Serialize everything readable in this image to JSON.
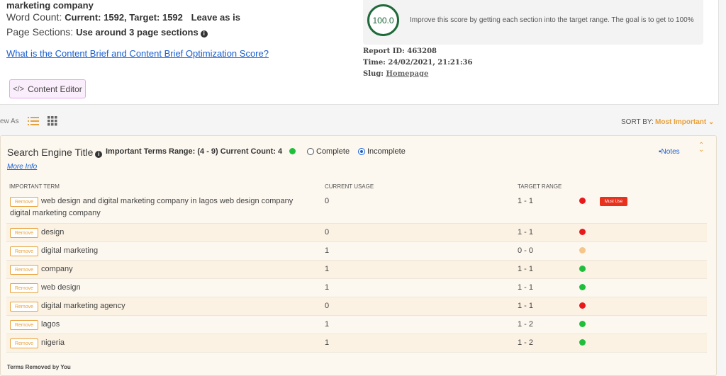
{
  "brief": {
    "company_line": "marketing company",
    "word_count_label": "Word Count:",
    "word_count_value": "Current: 1592, Target: 1592",
    "word_count_note": "Leave as is",
    "page_sections_label": "Page Sections:",
    "page_sections_value": "Use around 3 page sections",
    "brief_link": "What is the Content Brief and Content Brief Optimization Score?",
    "content_editor_label": "Content Editor"
  },
  "score": {
    "value": "100.0",
    "text": "Improve this score by getting each section into the target range. The goal is to get to 100%"
  },
  "report": {
    "id_label": "Report ID:",
    "id_value": "463208",
    "time_label": "Time:",
    "time_value": "24/02/2021, 21:21:36",
    "slug_label": "Slug:",
    "slug_value": "Homepage"
  },
  "view": {
    "view_as_label": "ew As",
    "sort_label": "SORT BY:",
    "sort_value": "Most Important",
    "sort_chevron": "⌄"
  },
  "section": {
    "title": "Search Engine Title",
    "terms_range": "Important Terms Range: (4 - 9) Current Count: 4",
    "status_color": "#1fbf3c",
    "complete_label": "Complete",
    "incomplete_label": "Incomplete",
    "selected": "Incomplete",
    "notes_label": "Notes",
    "collapse_glyph": "⌃",
    "more_info": "More Info",
    "headers": {
      "term": "IMPORTANT TERM",
      "usage": "CURRENT USAGE",
      "target": "TARGET RANGE"
    },
    "remove_label": "Remove",
    "must_use_label": "Must Use",
    "rows": [
      {
        "term": "web design and digital marketing company in lagos web design company digital marketing company",
        "usage": "0",
        "target": "1 - 1",
        "status": "red",
        "must_use": true
      },
      {
        "term": "design",
        "usage": "0",
        "target": "1 - 1",
        "status": "red",
        "must_use": false
      },
      {
        "term": "digital marketing",
        "usage": "1",
        "target": "0 - 0",
        "status": "orange",
        "must_use": false
      },
      {
        "term": "company",
        "usage": "1",
        "target": "1 - 1",
        "status": "green",
        "must_use": false
      },
      {
        "term": "web design",
        "usage": "1",
        "target": "1 - 1",
        "status": "green",
        "must_use": false
      },
      {
        "term": "digital marketing agency",
        "usage": "0",
        "target": "1 - 1",
        "status": "red",
        "must_use": false
      },
      {
        "term": "lagos",
        "usage": "1",
        "target": "1 - 2",
        "status": "green",
        "must_use": false
      },
      {
        "term": "nigeria",
        "usage": "1",
        "target": "1 - 2",
        "status": "green",
        "must_use": false
      }
    ],
    "status_colors": {
      "red": "#e8191b",
      "orange": "#f5c58a",
      "green": "#1fbf3c"
    },
    "removed_label": "Terms Removed by You"
  }
}
